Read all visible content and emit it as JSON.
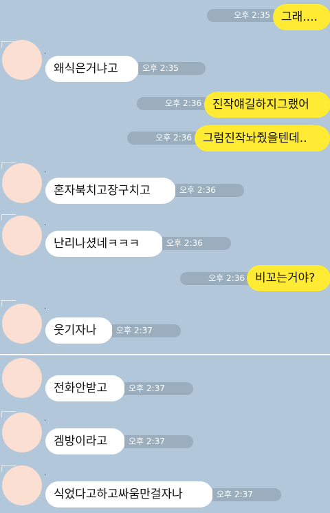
{
  "messages": [
    {
      "dir": "out",
      "text": "그래....",
      "time": "오후 2:35"
    },
    {
      "dir": "in",
      "text": "왜식은거냐고",
      "time": "오후 2:35"
    },
    {
      "dir": "out",
      "text": "진작얘길하지그랬어",
      "time": "오후 2:36"
    },
    {
      "dir": "out",
      "text": "그럼진작놔줬을텐데..",
      "time": "오후 2:36"
    },
    {
      "dir": "in",
      "text": "혼자북치고장구치고",
      "time": "오후 2:36"
    },
    {
      "dir": "in",
      "text": "난리나셨네ㅋㅋㅋ",
      "time": "오후 2:36"
    },
    {
      "dir": "out",
      "text": "비꼬는거야?",
      "time": "오후 2:36"
    },
    {
      "dir": "in",
      "text": "웃기자나",
      "time": "오후 2:37"
    },
    {
      "dir": "in",
      "text": "전화안받고",
      "time": "오후 2:37"
    },
    {
      "dir": "in",
      "text": "겜방이라고",
      "time": "오후 2:37"
    },
    {
      "dir": "in",
      "text": "식었다고하고싸움만걸자나",
      "time": "오후 2:37"
    }
  ],
  "sender_name": ".",
  "colors": {
    "background": "#b2c7d9",
    "outgoing_bubble": "#ffeb33",
    "incoming_bubble": "#ffffff",
    "time_pill": "#9aaebd",
    "avatar": "#fadfd2"
  }
}
